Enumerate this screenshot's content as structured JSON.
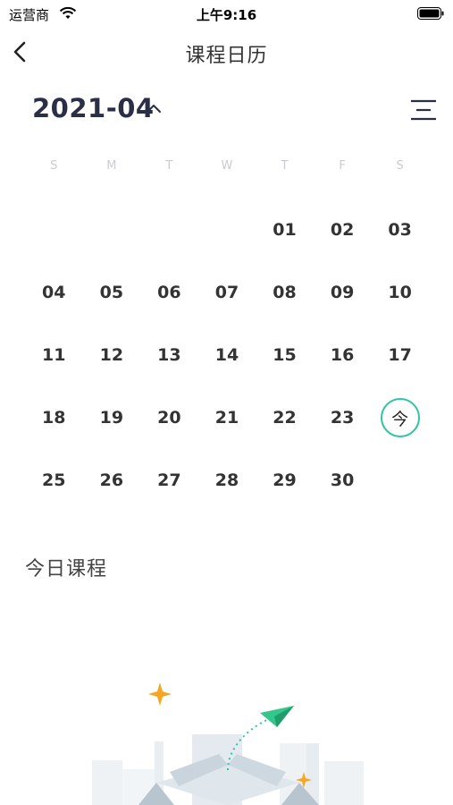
{
  "status_bar": {
    "carrier": "运营商",
    "time": "上午9:16"
  },
  "nav": {
    "title": "课程日历"
  },
  "calendar": {
    "month": "2021-04",
    "weekdays": [
      "S",
      "M",
      "T",
      "W",
      "T",
      "F",
      "S"
    ],
    "days": [
      "",
      "",
      "",
      "",
      "01",
      "02",
      "03",
      "04",
      "05",
      "06",
      "07",
      "08",
      "09",
      "10",
      "11",
      "12",
      "13",
      "14",
      "15",
      "16",
      "17",
      "18",
      "19",
      "20",
      "21",
      "22",
      "23",
      "今",
      "25",
      "26",
      "27",
      "28",
      "29",
      "30",
      ""
    ],
    "today_marker": "今",
    "accent_color": "#2ec4a4"
  },
  "today_section": {
    "title": "今日课程"
  }
}
